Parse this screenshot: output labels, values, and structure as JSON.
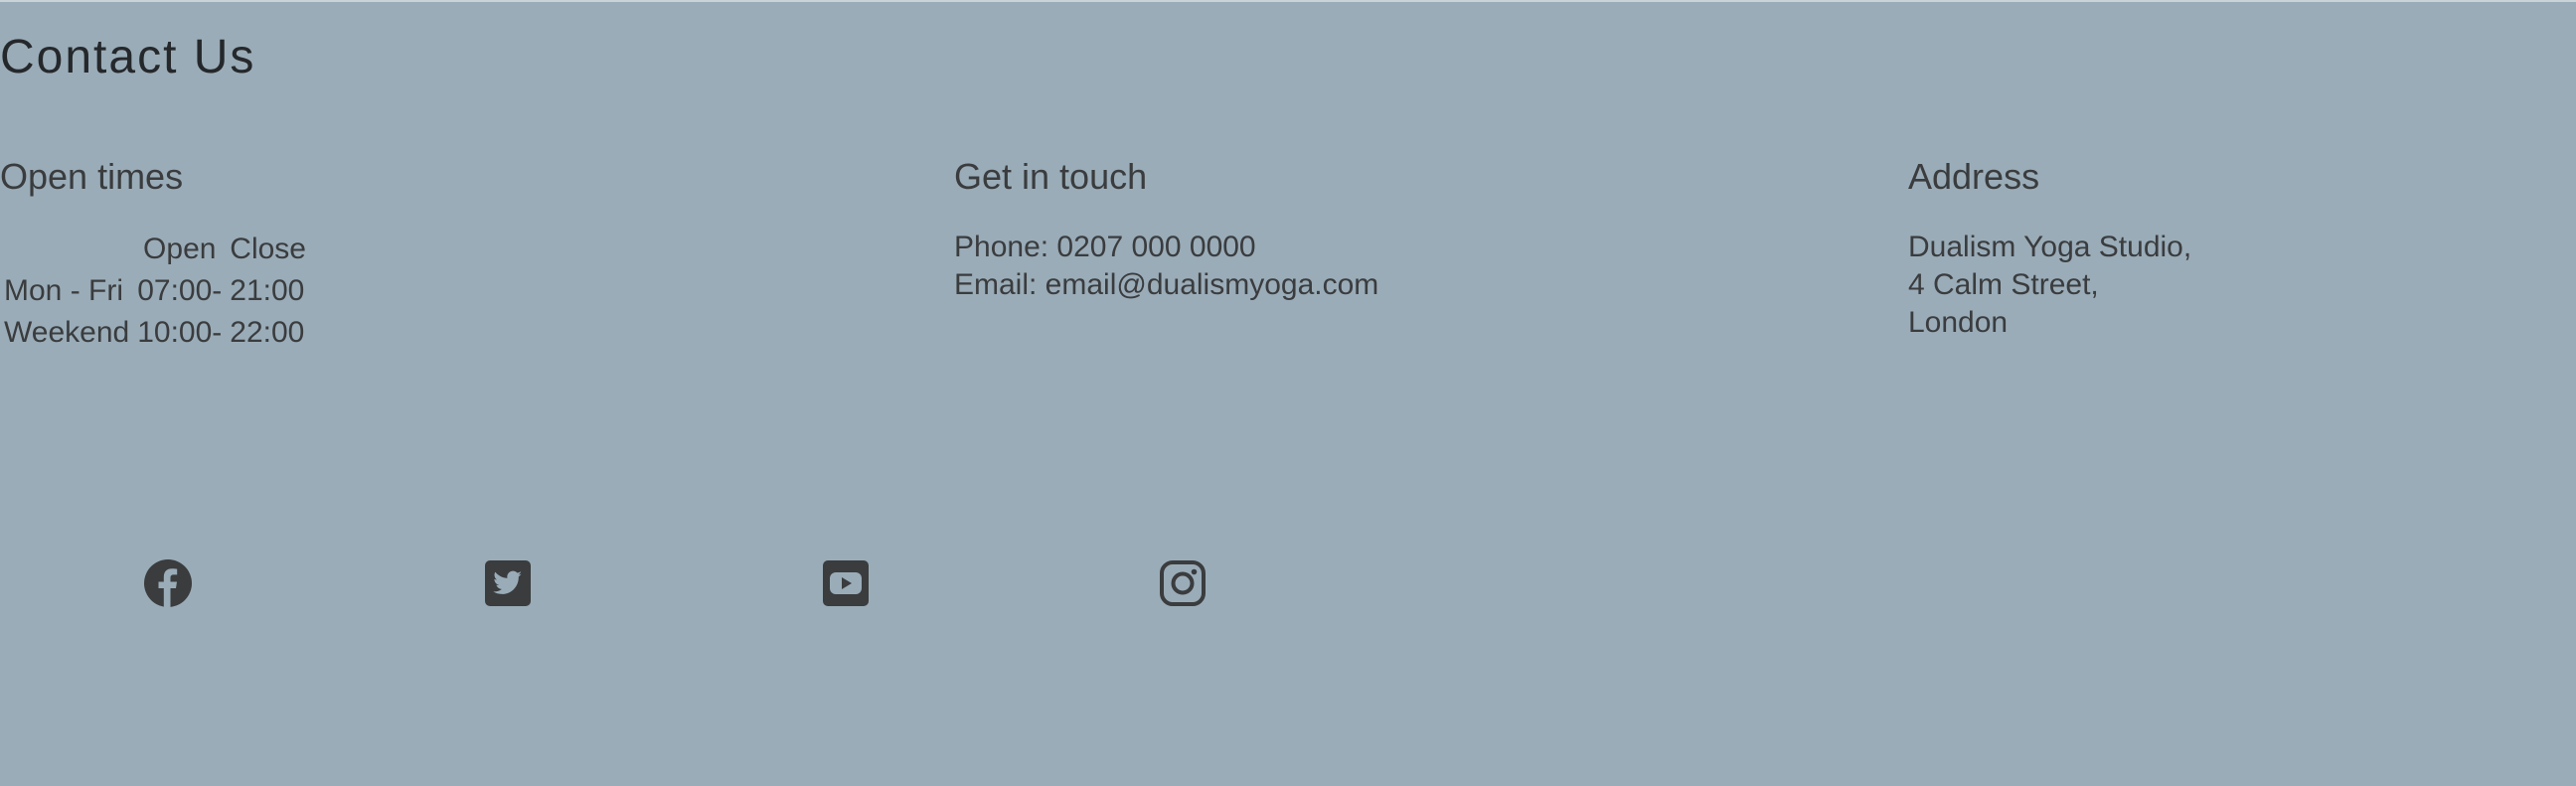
{
  "page": {
    "title": "Contact Us"
  },
  "open_times": {
    "heading": "Open times",
    "columns": [
      "",
      "Open",
      "Close"
    ],
    "rows": [
      {
        "day": "Mon - Fri",
        "open": "07:00-",
        "close": "21:00"
      },
      {
        "day": "Weekend",
        "open": "10:00-",
        "close": "22:00"
      }
    ]
  },
  "get_in_touch": {
    "heading": "Get in touch",
    "phone": "Phone: 0207 000 0000",
    "email": "Email: email@dualismyoga.com"
  },
  "address": {
    "heading": "Address",
    "lines": [
      "Dualism Yoga Studio,",
      "4 Calm Street,",
      "London"
    ]
  },
  "social": [
    {
      "icon": "facebook-icon"
    },
    {
      "icon": "twitter-icon"
    },
    {
      "icon": "youtube-icon"
    },
    {
      "icon": "instagram-icon"
    }
  ],
  "colors": {
    "background": "#9aacb8",
    "text": "#3a3c3e",
    "icon": "#3a3c3e"
  }
}
